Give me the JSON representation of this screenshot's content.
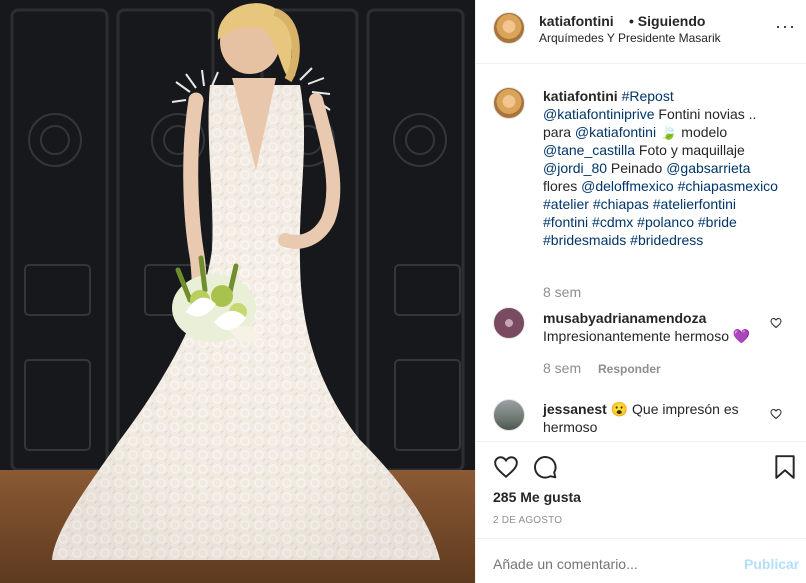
{
  "post": {
    "author": "katiafontini",
    "follow_status": "• Siguiendo",
    "location": "Arquímedes Y Presidente Masarik"
  },
  "caption": {
    "author": "katiafontini",
    "parts": [
      {
        "text": "#Repost",
        "tag": true
      },
      {
        "text": " ",
        "tag": false
      },
      {
        "text": "@katiafontiniprive",
        "tag": true
      },
      {
        "text": " Fontini novias .. para ",
        "tag": false
      },
      {
        "text": "@katiafontini",
        "tag": true
      },
      {
        "text": " 🍃 modelo ",
        "tag": false
      },
      {
        "text": "@tane_castilla",
        "tag": true
      },
      {
        "text": " Foto y maquillaje ",
        "tag": false
      },
      {
        "text": "@jordi_80",
        "tag": true
      },
      {
        "text": " Peinado ",
        "tag": false
      },
      {
        "text": "@gabsarrieta",
        "tag": true
      },
      {
        "text": " flores ",
        "tag": false
      },
      {
        "text": "@deloffmexico",
        "tag": true
      },
      {
        "text": " ",
        "tag": false
      },
      {
        "text": "#chiapasmexico",
        "tag": true
      },
      {
        "text": " ",
        "tag": false
      },
      {
        "text": "#atelier",
        "tag": true
      },
      {
        "text": " ",
        "tag": false
      },
      {
        "text": "#chiapas",
        "tag": true
      },
      {
        "text": " ",
        "tag": false
      },
      {
        "text": "#atelierfontini",
        "tag": true
      },
      {
        "text": " ",
        "tag": false
      },
      {
        "text": "#fontini",
        "tag": true
      },
      {
        "text": " ",
        "tag": false
      },
      {
        "text": "#cdmx",
        "tag": true
      },
      {
        "text": " ",
        "tag": false
      },
      {
        "text": "#polanco",
        "tag": true
      },
      {
        "text": " ",
        "tag": false
      },
      {
        "text": "#bride",
        "tag": true
      },
      {
        "text": " ",
        "tag": false
      },
      {
        "text": "#bridesmaids",
        "tag": true
      },
      {
        "text": " ",
        "tag": false
      },
      {
        "text": "#bridedress",
        "tag": true
      }
    ],
    "time": "8 sem"
  },
  "comments": [
    {
      "user": "musabyadrianamendoza",
      "text": "Impresionantemente hermoso 💜",
      "time": "8 sem",
      "reply": "Responder"
    },
    {
      "user": "jessanest",
      "text": "😮 Que impresón es hermoso"
    }
  ],
  "likes": "285 Me gusta",
  "date": "2 DE AGOSTO",
  "add_comment": {
    "placeholder": "Añade un comentario...",
    "publish": "Publicar"
  },
  "colors": {
    "tag": "#003569",
    "muted": "#8e8e8e",
    "publish": "#b2dffc",
    "border": "#efefef"
  },
  "icons": [
    "heart-icon",
    "comment-icon",
    "bookmark-icon",
    "more-options-icon"
  ]
}
